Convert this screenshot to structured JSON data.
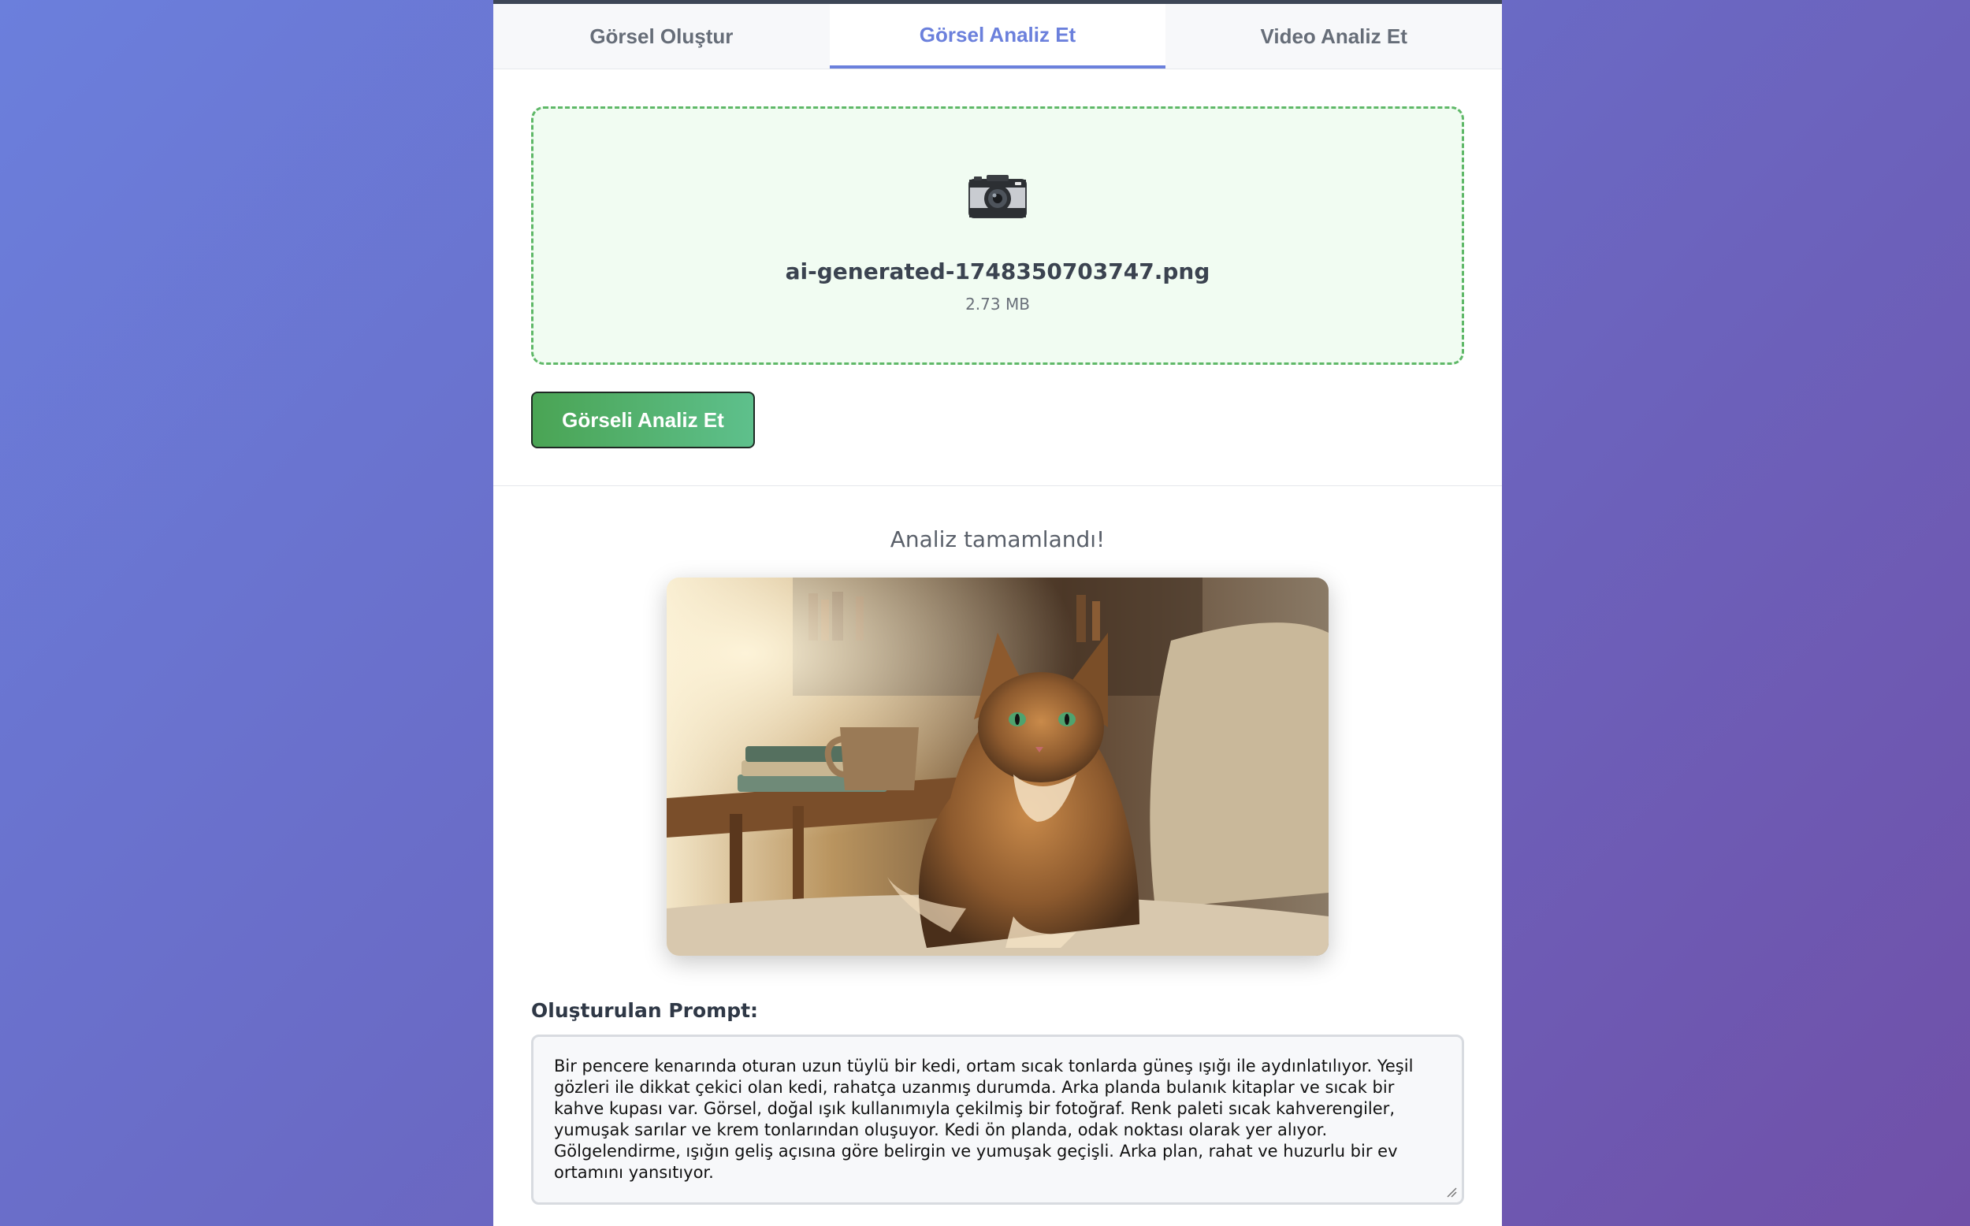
{
  "tabs": [
    {
      "label": "Görsel Oluştur",
      "active": false
    },
    {
      "label": "Görsel Analiz Et",
      "active": true
    },
    {
      "label": "Video Analiz Et",
      "active": false
    }
  ],
  "upload": {
    "icon": "camera-icon",
    "file_name": "ai-generated-1748350703747.png",
    "file_size": "2.73 MB"
  },
  "actions": {
    "analyze_label": "Görseli Analiz Et"
  },
  "result": {
    "status": "Analiz tamamlandı!",
    "image_subject": "cat-photo",
    "prompt_label": "Oluşturulan Prompt:",
    "prompt_text": "Bir pencere kenarında oturan uzun tüylü bir kedi, ortam sıcak tonlarda güneş ışığı ile aydınlatılıyor. Yeşil gözleri ile dikkat çekici olan kedi, rahatça uzanmış durumda. Arka planda bulanık kitaplar ve sıcak bir kahve kupası var. Görsel, doğal ışık kullanımıyla çekilmiş bir fotoğraf. Renk paleti sıcak kahverengiler, yumuşak sarılar ve krem tonlarından oluşuyor. Kedi ön planda, odak noktası olarak yer alıyor. Gölgelendirme, ışığın geliş açısına göre belirgin ve yumuşak geçişli. Arka plan, rahat ve huzurlu bir ev ortamını yansıtıyor."
  },
  "colors": {
    "accent": "#6b80dc",
    "success": "#4aa454",
    "dropzone_border": "#5fb868"
  }
}
